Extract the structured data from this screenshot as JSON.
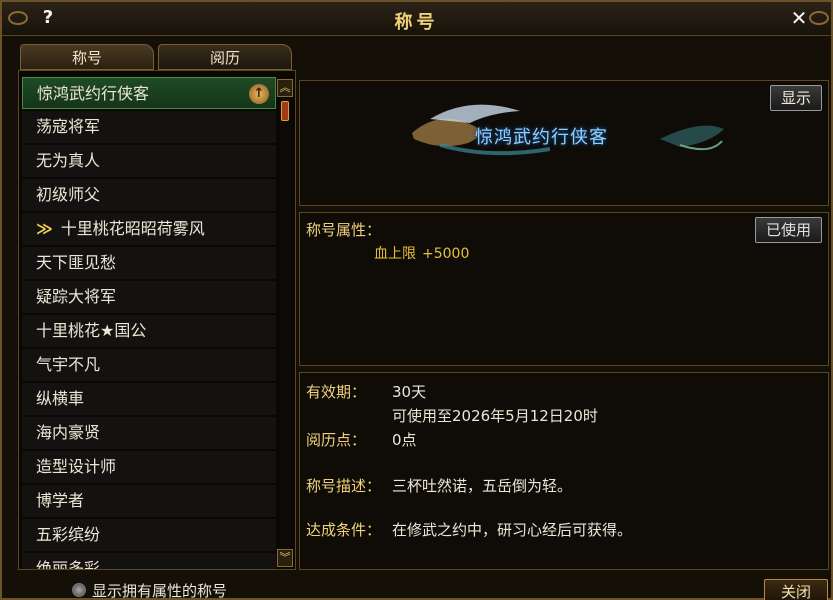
{
  "window": {
    "title": "称号",
    "help_icon": "?",
    "close_icon": "✕"
  },
  "tabs": [
    {
      "label": "称号",
      "active": true
    },
    {
      "label": "阅历",
      "active": false
    }
  ],
  "list": {
    "items": [
      {
        "label": "惊鸿武约行侠客",
        "selected": true,
        "badge": "↑"
      },
      {
        "label": "荡寇将军"
      },
      {
        "label": "无为真人"
      },
      {
        "label": "初级师父"
      },
      {
        "label": "十里桃花昭昭荷雾风",
        "prefix": "≫"
      },
      {
        "label": "天下匪见愁"
      },
      {
        "label": "疑踪大将军"
      },
      {
        "label": "十里桃花★国公"
      },
      {
        "label": "气宇不凡"
      },
      {
        "label": "纵横車"
      },
      {
        "label": "海内豪贤"
      },
      {
        "label": "造型设计师"
      },
      {
        "label": "博学者"
      },
      {
        "label": "五彩缤纷"
      },
      {
        "label": "绝丽多彩"
      }
    ]
  },
  "preview": {
    "show_button": "显示",
    "banner_text": "惊鸿武约行侠客"
  },
  "attributes": {
    "label": "称号属性：",
    "stat_name": "血上限",
    "stat_value": "+5000",
    "used_button": "已使用"
  },
  "details": {
    "validity_label": "有效期：",
    "validity_value": "30天",
    "validity_until": "可使用至2026年5月12日20时",
    "points_label": "阅历点：",
    "points_value": "0点",
    "desc_label": "称号描述：",
    "desc_value": "三杯吐然诺，五岳倒为轻。",
    "cond_label": "达成条件：",
    "cond_value": "在修武之约中，研习心经后可获得。"
  },
  "footer": {
    "checkbox_label": "显示拥有属性的称号",
    "close_button": "关闭"
  },
  "colors": {
    "accent_gold": "#f0d27a",
    "selected_green": "#1f4a26",
    "banner_blue": "#8ed0f8"
  }
}
